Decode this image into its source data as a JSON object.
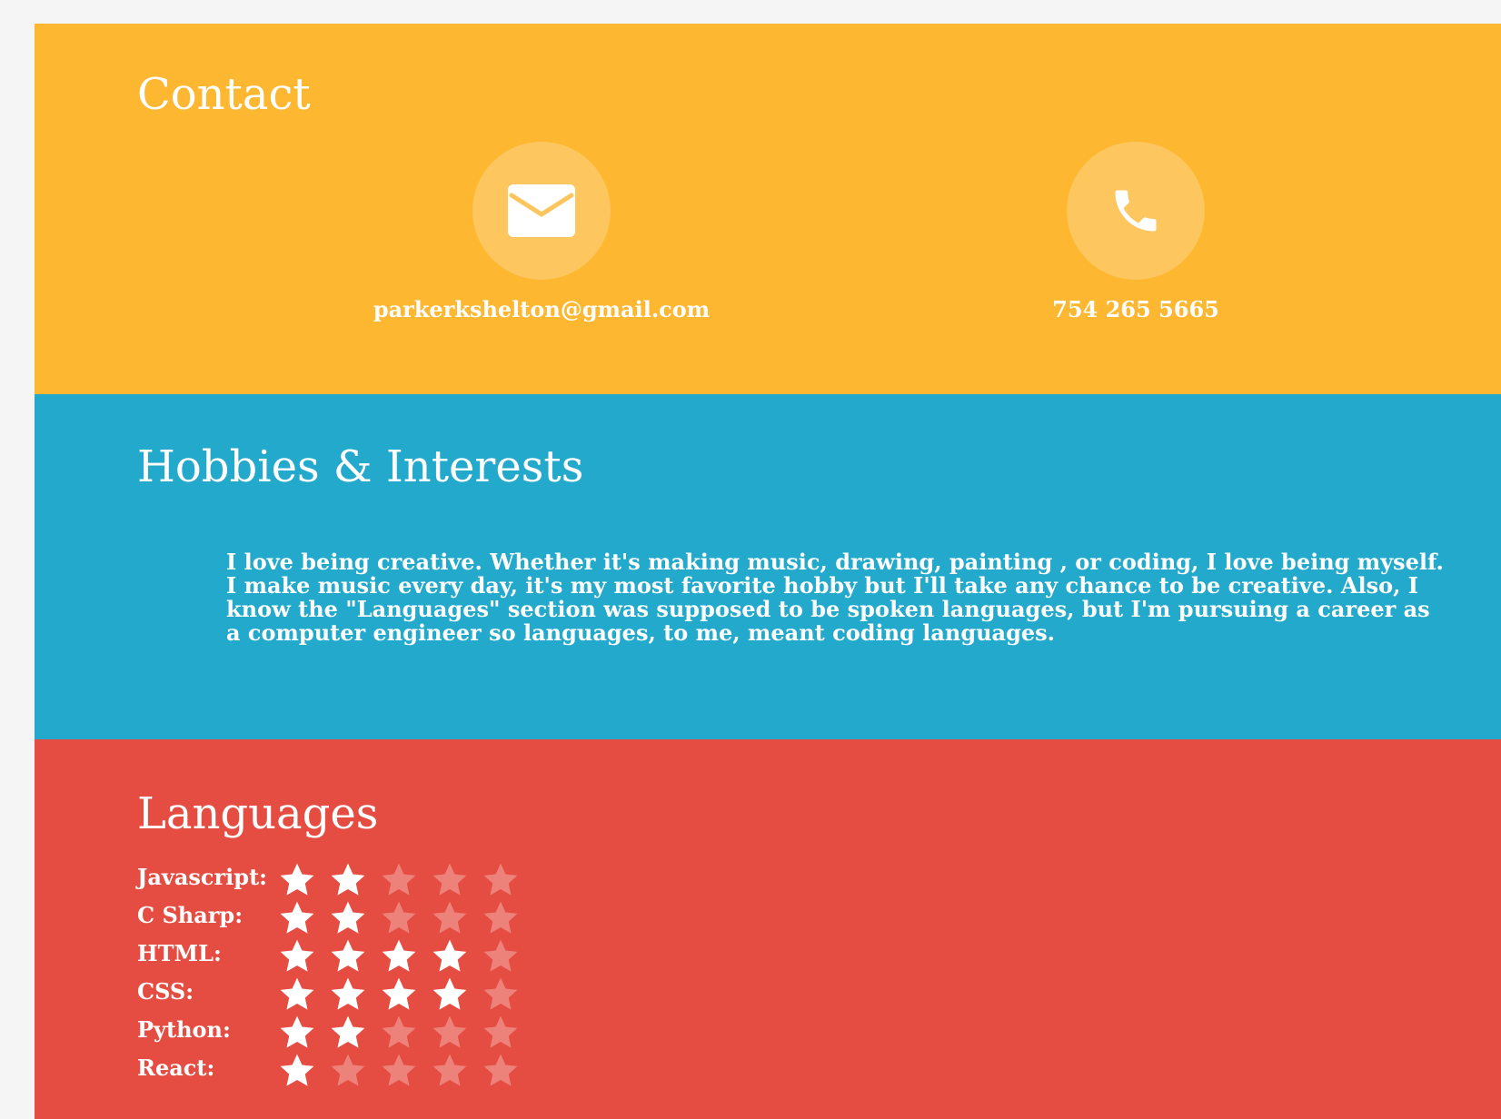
{
  "contact": {
    "title": "Contact",
    "email": "parkerkshelton@gmail.com",
    "phone": "754 265 5665",
    "email_icon": "envelope-icon",
    "phone_icon": "phone-icon"
  },
  "hobbies": {
    "title": "Hobbies & Interests",
    "text": "I love being creative. Whether it's making music, drawing, painting , or coding, I love being myself. I make music every day, it's my most favorite hobby but I'll take any chance to be creative. Also, I know the \"Languages\" section was supposed to be spoken languages, but I'm pursuing a career as a computer engineer so languages, to me, meant coding languages."
  },
  "languages": {
    "title": "Languages",
    "max_rating": 5,
    "items": [
      {
        "name": "Javascript:",
        "rating": 2
      },
      {
        "name": "C Sharp:",
        "rating": 2
      },
      {
        "name": "HTML:",
        "rating": 4
      },
      {
        "name": "CSS:",
        "rating": 4
      },
      {
        "name": "Python:",
        "rating": 2
      },
      {
        "name": "React:",
        "rating": 1
      }
    ]
  },
  "colors": {
    "contact_bg": "#fdb731",
    "hobbies_bg": "#23a9cc",
    "languages_bg": "#e54d42",
    "page_bg": "#f5f5f5"
  }
}
